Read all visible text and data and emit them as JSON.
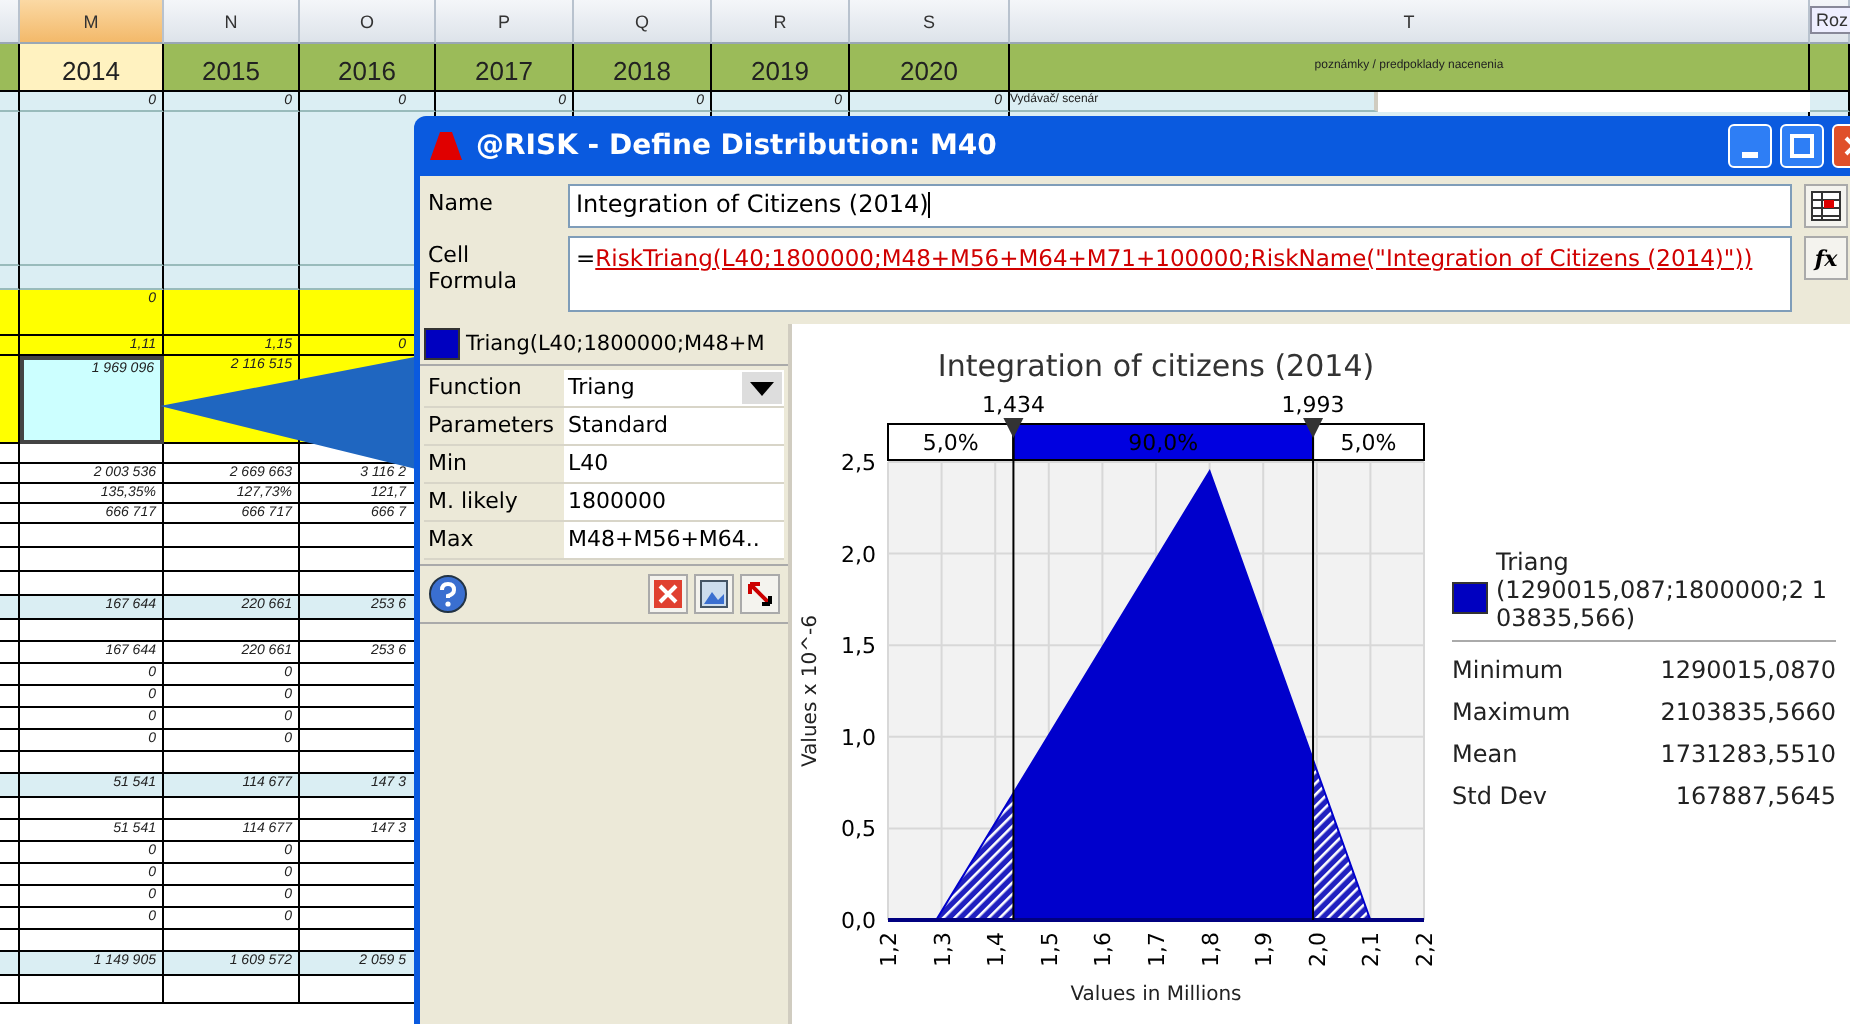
{
  "sheet": {
    "columns": [
      {
        "letter": "M",
        "year": "2014",
        "selected": true
      },
      {
        "letter": "N",
        "year": "2015",
        "selected": false
      },
      {
        "letter": "O",
        "year": "2016",
        "selected": false
      },
      {
        "letter": "P",
        "year": "2017",
        "selected": false
      },
      {
        "letter": "Q",
        "year": "2018",
        "selected": false
      },
      {
        "letter": "R",
        "year": "2019",
        "selected": false
      },
      {
        "letter": "S",
        "year": "2020",
        "selected": false
      },
      {
        "letter": "T",
        "year": "poznámky / predpoklady nacenenia",
        "selected": false
      }
    ],
    "corner_button": "Roz",
    "first_row": [
      "0",
      "0",
      "0",
      "0",
      "0",
      "0",
      "0",
      "Vydávač/ scenár"
    ],
    "rows": [
      {
        "kind": "light",
        "selected": false,
        "cells": []
      },
      {
        "kind": "light",
        "selected": false,
        "cells": []
      },
      {
        "kind": "yellow",
        "selected": false,
        "cells": [
          "0"
        ]
      },
      {
        "kind": "yellow",
        "selected": false,
        "cells": [
          "1,11",
          "1,15",
          "0"
        ]
      },
      {
        "kind": "yellow",
        "selected": true,
        "cells": [
          "1 969 096",
          "2 116 515"
        ]
      },
      {
        "kind": "plain",
        "selected": false,
        "cells": []
      },
      {
        "kind": "plain",
        "selected": false,
        "cells": [
          "2 003 536",
          "2 669 663",
          "3 116 2"
        ]
      },
      {
        "kind": "plain",
        "selected": false,
        "cells": [
          "135,35%",
          "127,73%",
          "121,7"
        ]
      },
      {
        "kind": "plain",
        "selected": false,
        "cells": [
          "666 717",
          "666 717",
          "666 7"
        ]
      },
      {
        "kind": "plain",
        "selected": false,
        "cells": []
      },
      {
        "kind": "plain",
        "selected": false,
        "cells": []
      },
      {
        "kind": "plain",
        "selected": false,
        "cells": []
      },
      {
        "kind": "blue",
        "selected": false,
        "cells": [
          "167 644",
          "220 661",
          "253 6"
        ]
      },
      {
        "kind": "plain",
        "selected": false,
        "cells": []
      },
      {
        "kind": "plain",
        "selected": false,
        "cells": [
          "167 644",
          "220 661",
          "253 6"
        ]
      },
      {
        "kind": "plain",
        "selected": false,
        "cells": [
          "0",
          "0"
        ]
      },
      {
        "kind": "plain",
        "selected": false,
        "cells": [
          "0",
          "0"
        ]
      },
      {
        "kind": "plain",
        "selected": false,
        "cells": [
          "0",
          "0"
        ]
      },
      {
        "kind": "plain",
        "selected": false,
        "cells": [
          "0",
          "0"
        ]
      },
      {
        "kind": "plain",
        "selected": false,
        "cells": []
      },
      {
        "kind": "blue",
        "selected": false,
        "cells": [
          "51 541",
          "114 677",
          "147 3"
        ]
      },
      {
        "kind": "plain",
        "selected": false,
        "cells": []
      },
      {
        "kind": "plain",
        "selected": false,
        "cells": [
          "51 541",
          "114 677",
          "147 3"
        ]
      },
      {
        "kind": "plain",
        "selected": false,
        "cells": [
          "0",
          "0"
        ]
      },
      {
        "kind": "plain",
        "selected": false,
        "cells": [
          "0",
          "0"
        ]
      },
      {
        "kind": "plain",
        "selected": false,
        "cells": [
          "0",
          "0"
        ]
      },
      {
        "kind": "plain",
        "selected": false,
        "cells": [
          "0",
          "0"
        ]
      },
      {
        "kind": "plain",
        "selected": false,
        "cells": []
      },
      {
        "kind": "blue",
        "selected": false,
        "cells": [
          "1 149 905",
          "1 609 572",
          "2 059 5"
        ]
      },
      {
        "kind": "plain",
        "selected": false,
        "cells": []
      }
    ]
  },
  "dialog": {
    "title": "@RISK - Define Distribution: M40",
    "name_label": "Name",
    "name_value": "Integration of Citizens (2014)",
    "formula_label": "Cell Formula",
    "formula_prefix": "=",
    "formula": "RiskTriang(L40;1800000;M48+M56+M64+M71+100000;RiskName(\"Integration of Citizens (2014)\"))",
    "fx_button": "fx",
    "distribution_header": "Triang(L40;1800000;M48+M",
    "properties": [
      {
        "label": "Function",
        "value": "Triang",
        "kind": "dropdown"
      },
      {
        "label": "Parameters",
        "value": "Standard",
        "kind": "text"
      },
      {
        "label": "Min",
        "value": "L40",
        "kind": "text"
      },
      {
        "label": "M. likely",
        "value": "1800000",
        "kind": "text"
      },
      {
        "label": "Max",
        "value": "M48+M56+M64..",
        "kind": "text"
      }
    ],
    "chart": {
      "chart_data": {
        "type": "area",
        "title": "Integration of citizens (2014)",
        "xlabel": "Values in Millions",
        "ylabel": "Values x 10^-6",
        "grid": true,
        "x": [
          1.2,
          1.29,
          1.8,
          2.1,
          2.2
        ],
        "values": [
          0,
          0,
          2.45,
          0,
          0
        ],
        "xlim": [
          1.2,
          2.2
        ],
        "ylim": [
          0,
          2.5
        ],
        "xticks": [
          {
            "value": 1.2,
            "label": "1,2"
          },
          {
            "value": 1.3,
            "label": "1,3"
          },
          {
            "value": 1.4,
            "label": "1,4"
          },
          {
            "value": 1.5,
            "label": "1,5"
          },
          {
            "value": 1.6,
            "label": "1,6"
          },
          {
            "value": 1.7,
            "label": "1,7"
          },
          {
            "value": 1.8,
            "label": "1,8"
          },
          {
            "value": 1.9,
            "label": "1,9"
          },
          {
            "value": 2.0,
            "label": "2,0"
          },
          {
            "value": 2.1,
            "label": "2,1"
          },
          {
            "value": 2.2,
            "label": "2,2"
          }
        ],
        "yticks": [
          {
            "value": 0,
            "label": "0,0"
          },
          {
            "value": 0.5,
            "label": "0,5"
          },
          {
            "value": 1,
            "label": "1,0"
          },
          {
            "value": 1.5,
            "label": "1,5"
          },
          {
            "value": 2,
            "label": "2,0"
          },
          {
            "value": 2.5,
            "label": "2,5"
          }
        ],
        "ref_lines": [
          {
            "axis": "x",
            "value": 1.434,
            "label": "1,434"
          },
          {
            "axis": "x",
            "value": 1.993,
            "label": "1,993"
          }
        ]
      },
      "band_labels": [
        "5,0%",
        "90,0%",
        "5,0%"
      ]
    },
    "legend": {
      "name": "Triang",
      "params": "(1290015,087;1800000;2 103835,566)",
      "color": "#0000c0"
    },
    "stats": [
      {
        "label": "Minimum",
        "value": "1290015,0870"
      },
      {
        "label": "Maximum",
        "value": "2103835,5660"
      },
      {
        "label": "Mean",
        "value": "1731283,5510"
      },
      {
        "label": "Std Dev",
        "value": "167887,5645"
      }
    ]
  }
}
